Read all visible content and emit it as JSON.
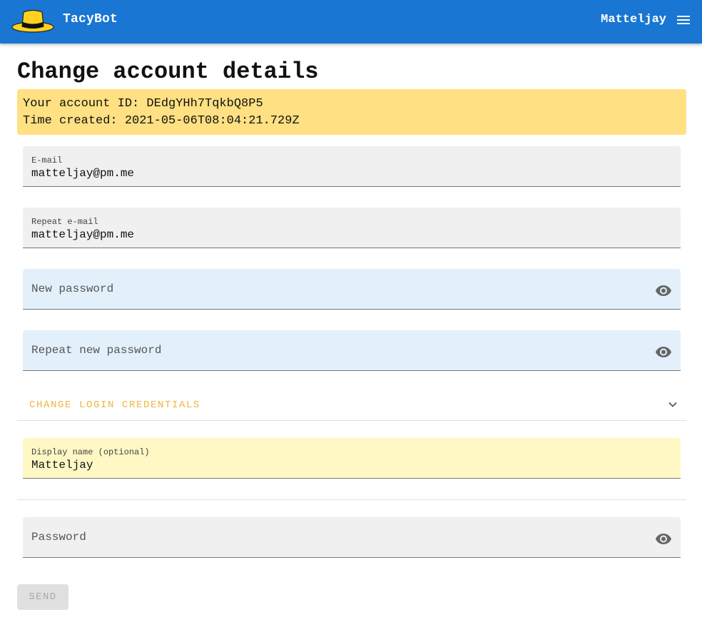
{
  "header": {
    "brand": "TacyBot",
    "username": "Matteljay",
    "colors": {
      "bar": "#1976d2",
      "hat": "#ffd21f"
    }
  },
  "page": {
    "title": "Change account details",
    "info": {
      "account_id_line": "Your account ID: DEdgYHh7TqkbQ8P5",
      "created_line": "Time created: 2021-05-06T08:04:21.729Z"
    }
  },
  "form": {
    "email": {
      "label": "E-mail",
      "value": "matteljay@pm.me"
    },
    "repeat_email": {
      "label": "Repeat e-mail",
      "value": "matteljay@pm.me"
    },
    "new_password": {
      "placeholder": "New password",
      "icon": "eye-icon"
    },
    "repeat_new_password": {
      "placeholder": "Repeat new password",
      "icon": "eye-icon"
    },
    "credentials_section": {
      "label": "CHANGE LOGIN CREDENTIALS",
      "icon": "chevron-down-icon",
      "color": "#f0b441"
    },
    "display_name": {
      "label": "Display name (optional)",
      "value": "Matteljay"
    },
    "password": {
      "placeholder": "Password",
      "icon": "eye-icon"
    },
    "send_label": "SEND"
  }
}
